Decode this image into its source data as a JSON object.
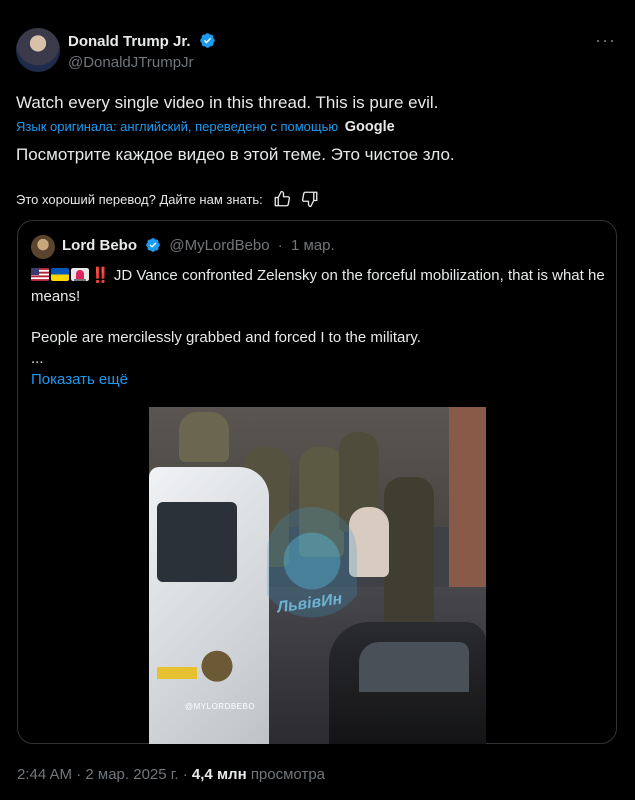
{
  "author": {
    "name": "Donald Trump Jr.",
    "handle": "@DonaldJTrumpJr",
    "verified_color": "#1d9bf0"
  },
  "tweet": {
    "text": "Watch every single video in this thread. This is pure evil.",
    "translated_by_label": "Язык оригинала: английский, переведено с помощью",
    "translator": "Google",
    "translation": "Посмотрите каждое видео в этой теме. Это чистое зло.",
    "feedback_prompt": "Это хороший перевод? Дайте нам знать:"
  },
  "quote": {
    "name": "Lord Bebo",
    "handle": "@MyLordBebo",
    "separator": "·",
    "date": "1 мар.",
    "emoji": "‼️",
    "line1": " JD Vance confronted Zelensky on the forceful mobilization, that is what he means!",
    "line2": "People are mercilessly grabbed and forced I to the military.",
    "ellipsis": "...",
    "show_more": "Показать ещё",
    "video": {
      "watermark": "ЛьвівИн",
      "credit": "@MYLORDBEBO"
    }
  },
  "footer": {
    "time": "2:44 AM",
    "sep1": "·",
    "date": "2 мар. 2025 г.",
    "sep2": "·",
    "views": "4,4 млн",
    "views_label": "просмотра"
  },
  "icons": {
    "more": "more-icon",
    "thumbs_up": "thumbs-up-icon",
    "thumbs_down": "thumbs-down-icon",
    "verified": "verified-badge-icon"
  },
  "colors": {
    "background": "#000000",
    "text": "#e7e9ea",
    "secondary": "#71767b",
    "accent": "#1d9bf0",
    "border": "#2f3336"
  }
}
